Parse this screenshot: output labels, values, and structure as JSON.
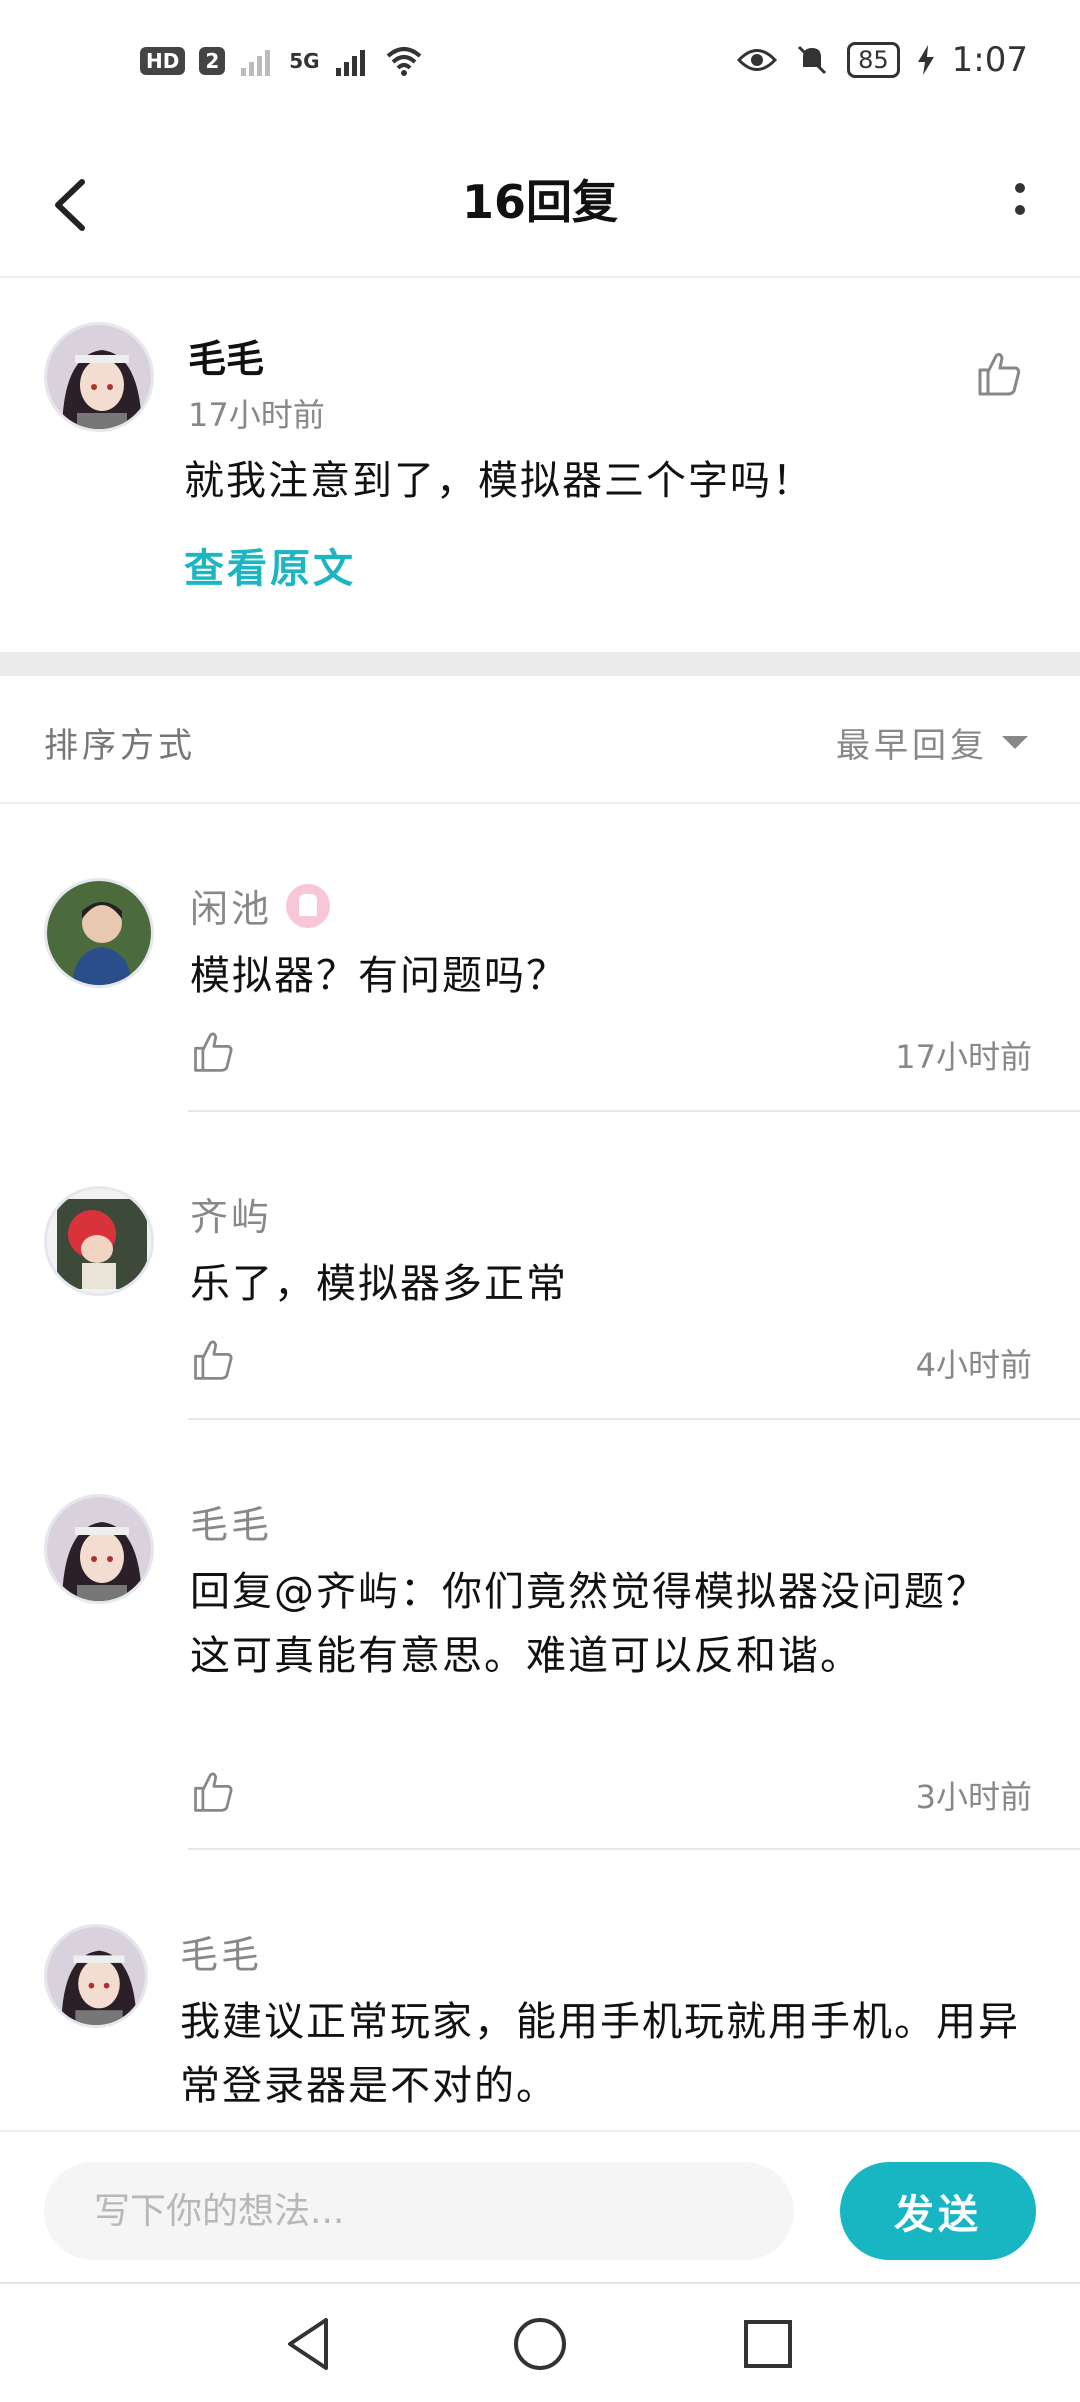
{
  "status_bar": {
    "left_badges": [
      "HD",
      "2"
    ],
    "network": "5G",
    "battery": "85",
    "time": "1:07"
  },
  "header": {
    "title": "16回复"
  },
  "original_post": {
    "author": "毛毛",
    "time": "17小时前",
    "text": "就我注意到了，模拟器三个字吗！",
    "view_original": "查看原文"
  },
  "sort": {
    "label": "排序方式",
    "value": "最早回复"
  },
  "replies": [
    {
      "author": "闲池",
      "text": "模拟器？有问题吗？",
      "time": "17小时前"
    },
    {
      "author": "齐屿",
      "text": "乐了，模拟器多正常",
      "time": "4小时前"
    },
    {
      "author": "毛毛",
      "text": "回复@齐屿：你们竟然觉得模拟器没问题？这可真能有意思。难道可以反和谐。",
      "time": "3小时前"
    },
    {
      "author": "毛毛",
      "text": "我建议正常玩家，能用手机玩就用手机。用异常登录器是不对的。",
      "time": ""
    }
  ],
  "composer": {
    "placeholder": "写下你的想法...",
    "send_label": "发送"
  },
  "colors": {
    "accent": "#18b6c2"
  }
}
